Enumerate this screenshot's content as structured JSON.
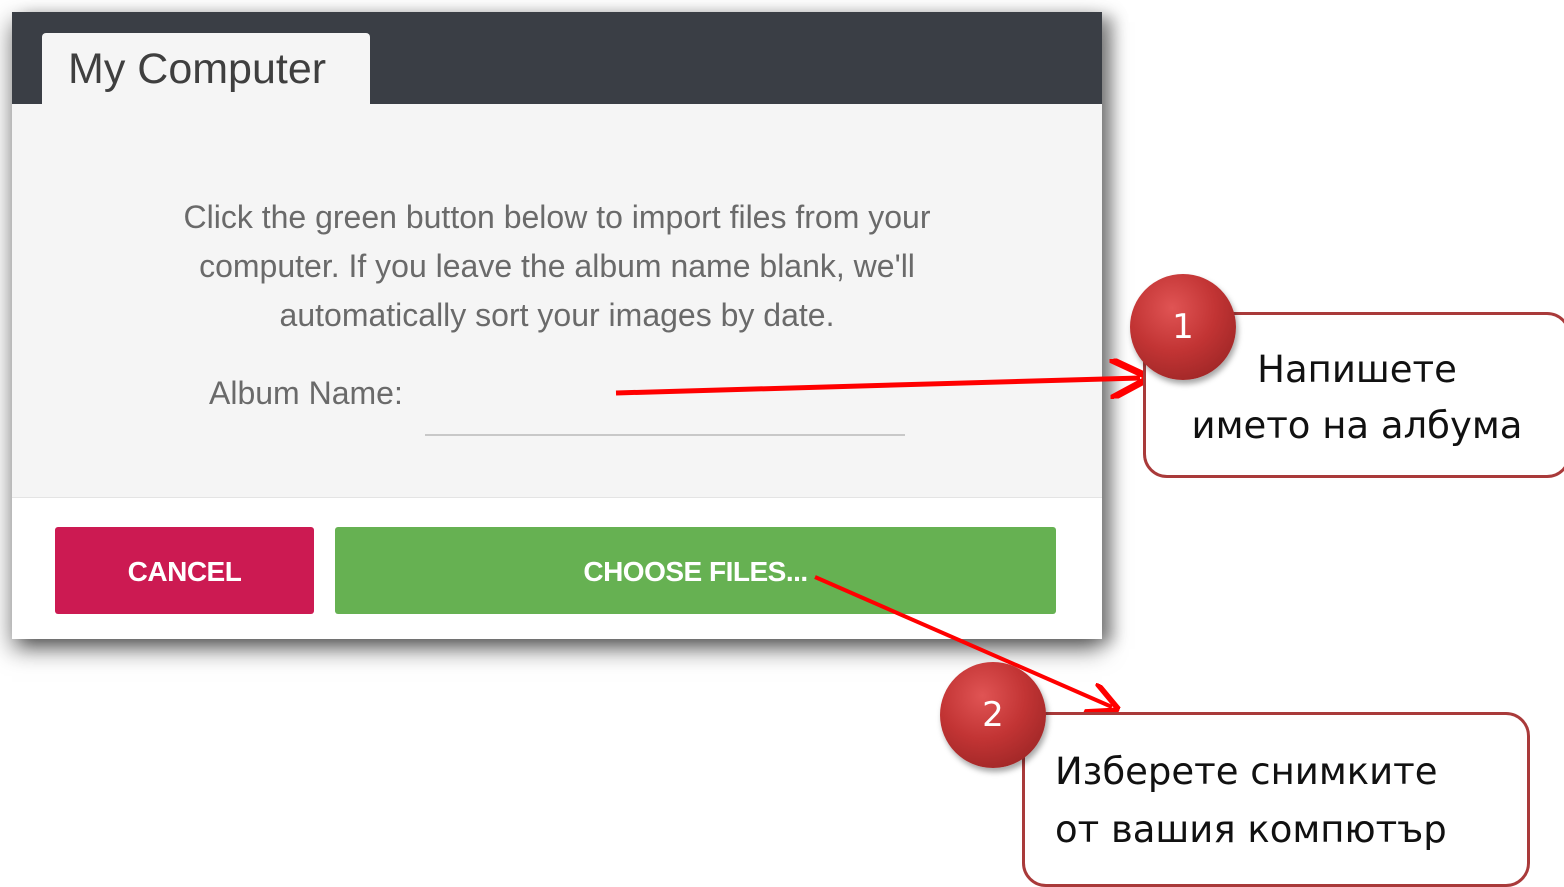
{
  "dialog": {
    "tab_label": "My Computer",
    "instructions": "Click the green button below to import files from your computer. If you leave the album name blank, we'll automatically sort your images by date.",
    "album_label": "Album Name:",
    "album_value": "",
    "cancel_label": "CANCEL",
    "choose_label": "CHOOSE FILES...",
    "colors": {
      "header": "#3a3e45",
      "cancel": "#cc1a52",
      "choose": "#66b152"
    }
  },
  "annotations": [
    {
      "number": "1",
      "line1": "Напишете",
      "line2": "името на албума"
    },
    {
      "number": "2",
      "line1": "Изберете снимките",
      "line2": "от вашия компютър"
    }
  ],
  "annotation_color": "#ff0000"
}
